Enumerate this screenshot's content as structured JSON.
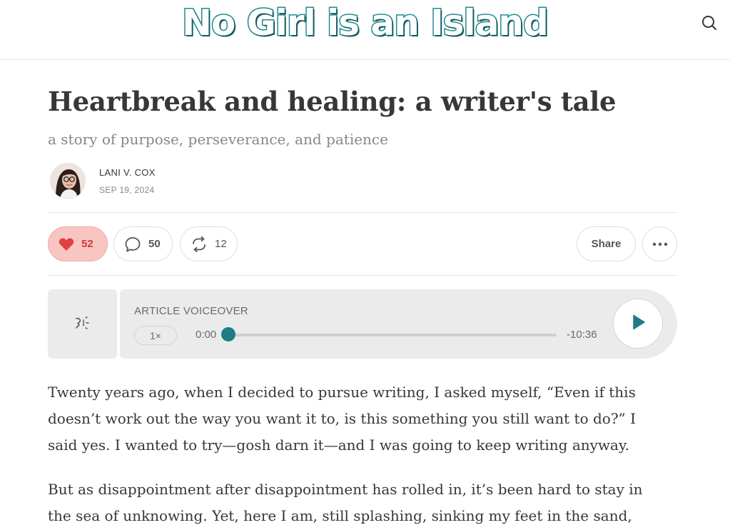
{
  "header": {
    "site_title": "No Girl is an Island",
    "search_icon": "search-icon"
  },
  "post": {
    "title": "Heartbreak and healing: a writer's tale",
    "subtitle": "a story of purpose, perseverance, and patience",
    "author": "LANI V. COX",
    "date": "SEP 19, 2024"
  },
  "actions": {
    "likes": "52",
    "comments": "50",
    "restacks": "12",
    "share_label": "Share",
    "like_color": "#e0413c"
  },
  "voiceover": {
    "label": "ARTICLE VOICEOVER",
    "speed": "1×",
    "current_time": "0:00",
    "remaining_time": "-10:36",
    "progress": 0,
    "accent": "#1f7c87"
  },
  "body": {
    "p1_lines": [
      "Twenty years ago, when I decided to pursue writing, I asked myself, “Even if this",
      "doesn’t work out the way you want it to, is this something you still want to do?” I",
      "said yes. I wanted to try—gosh darn it—and I was going to keep writing anyway."
    ],
    "p2_lines": [
      "But as disappointment after disappointment has rolled in, it’s been hard to stay in",
      "the sea of unknowing. Yet, here I am, still splashing, sinking my feet in the sand,"
    ]
  }
}
